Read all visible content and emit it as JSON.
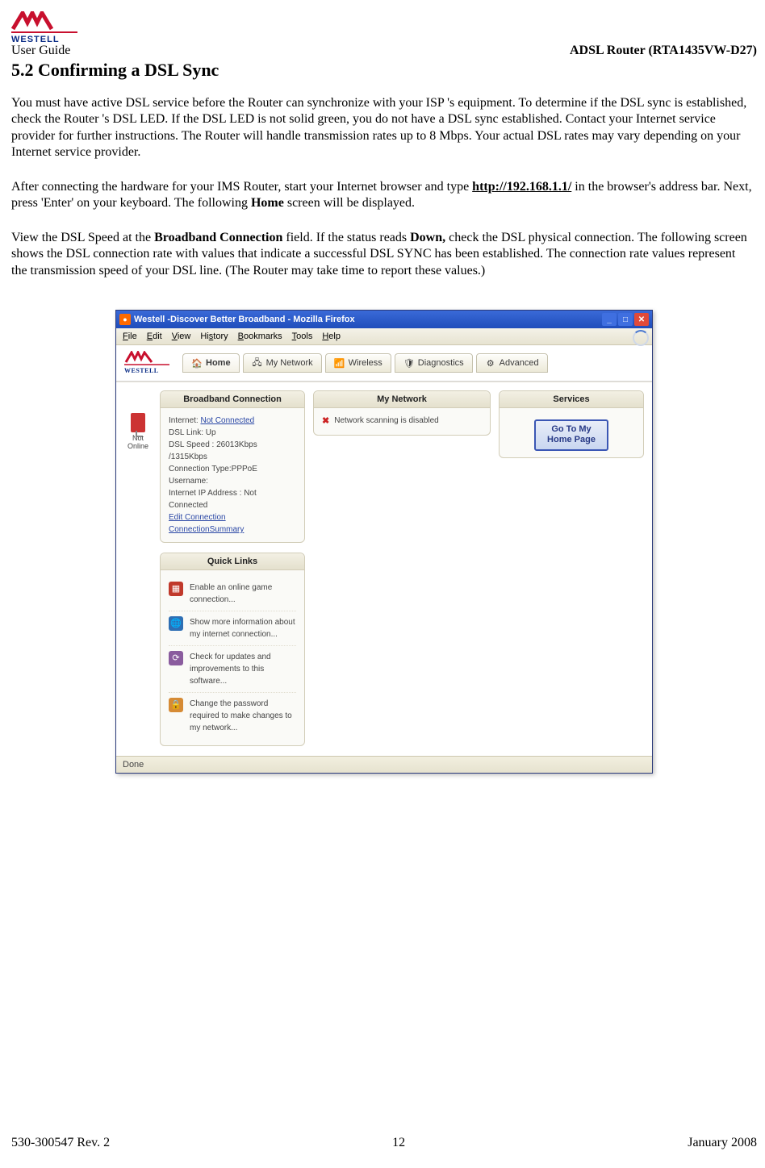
{
  "brand": {
    "name": "WESTELL"
  },
  "doc": {
    "guide_label": "User Guide",
    "model_label": "ADSL Router (RTA1435VW-D27)",
    "section_title": "5.2 Confirming a DSL Sync",
    "para1": "You must have active DSL service before the Router can synchronize with your ISP 's equipment. To determine if the DSL sync is established, check the Router 's DSL LED. If the DSL LED is not solid green, you do not have a DSL sync established. Contact your Internet service provider for further instructions. The Router will handle transmission rates up to 8 Mbps. Your actual DSL rates may vary depending on your Internet service provider.",
    "para2_pre": "After connecting the hardware for your IMS Router, start your Internet browser and type  ",
    "para2_link": "http://192.168.1.1/",
    "para2_post1": " in the browser's address bar. Next, press  'Enter' on your keyboard. The following ",
    "para2_bold": "Home",
    "para2_post2": " screen will be displayed.",
    "para3_pre": "View the DSL Speed at the ",
    "para3_b1": "Broadband Connection",
    "para3_mid": " field. If the status reads ",
    "para3_b2": "Down,",
    "para3_post": " check the DSL physical connection. The following screen shows the DSL connection rate with values that indicate a successful DSL SYNC has been established. The connection rate values represent the transmission speed of your DSL line. (The Router may take time to report these values.)"
  },
  "footer": {
    "left": "530-300547 Rev. 2",
    "center": "12",
    "right": "January 2008"
  },
  "screenshot": {
    "window_title": "Westell -Discover Better Broadband - Mozilla Firefox",
    "menu": {
      "file": "File",
      "edit": "Edit",
      "view": "View",
      "history": "History",
      "bookmarks": "Bookmarks",
      "tools": "Tools",
      "help": "Help"
    },
    "tabs": {
      "home": "Home",
      "mynetwork": "My Network",
      "wireless": "Wireless",
      "diagnostics": "Diagnostics",
      "advanced": "Advanced"
    },
    "not_online_label": "Not Online",
    "broadband": {
      "header": "Broadband Connection",
      "internet_label": "Internet: ",
      "internet_link": "Not Connected",
      "dsl_link": "DSL Link: Up",
      "dsl_speed": "DSL Speed : 26013Kbps /1315Kbps",
      "conn_type": "Connection Type:PPPoE",
      "username": "Username:",
      "ip": "Internet IP Address : Not Connected",
      "edit_conn": "Edit Connection",
      "conn_summary": "ConnectionSummary"
    },
    "mynet": {
      "header": "My Network",
      "text": "Network scanning is disabled"
    },
    "services": {
      "header": "Services",
      "btn_l1": "Go To My",
      "btn_l2": "Home Page"
    },
    "quicklinks": {
      "header": "Quick Links",
      "items": [
        "Enable an online game connection...",
        "Show more information about my internet connection...",
        "Check for updates and improvements to this software...",
        "Change the password required to make changes to my network..."
      ]
    },
    "status": "Done"
  }
}
